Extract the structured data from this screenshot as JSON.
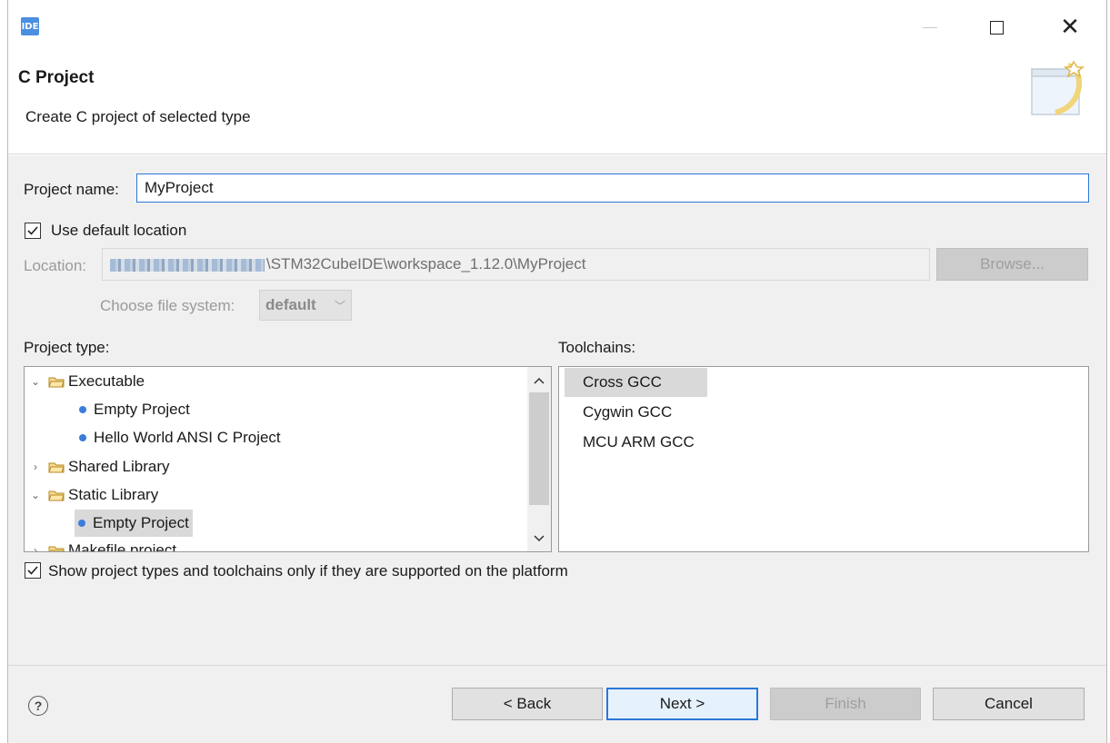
{
  "window": {
    "app_icon": "IDE",
    "min_icon": "minimize-icon",
    "max_icon": "maximize-icon",
    "close_icon": "close-icon"
  },
  "header": {
    "title": "C Project",
    "description": "Create C project of selected type"
  },
  "form": {
    "project_name_label": "Project name:",
    "project_name_value": "MyProject",
    "use_default_location_label": "Use default location",
    "use_default_location_checked": true,
    "location_label": "Location:",
    "location_value_suffix": "\\STM32CubeIDE\\workspace_1.12.0\\MyProject",
    "browse_label": "Browse...",
    "file_system_label": "Choose file system:",
    "file_system_value": "default"
  },
  "project_type": {
    "label": "Project type:",
    "items": [
      {
        "label": "Executable",
        "kind": "folder",
        "expanded": true
      },
      {
        "label": "Empty Project",
        "kind": "leaf"
      },
      {
        "label": "Hello World ANSI C Project",
        "kind": "leaf"
      },
      {
        "label": "Shared Library",
        "kind": "folder",
        "expanded": false
      },
      {
        "label": "Static Library",
        "kind": "folder",
        "expanded": true
      },
      {
        "label": "Empty Project",
        "kind": "leaf",
        "selected": true
      },
      {
        "label": "Makefile project",
        "kind": "folder",
        "expanded": false
      }
    ]
  },
  "toolchains": {
    "label": "Toolchains:",
    "items": [
      {
        "label": "Cross GCC",
        "selected": true
      },
      {
        "label": "Cygwin GCC"
      },
      {
        "label": "MCU ARM GCC"
      }
    ]
  },
  "filter": {
    "label": "Show project types and toolchains only if they are supported on the platform",
    "checked": true
  },
  "footer": {
    "help_icon": "help-icon",
    "back_label": "< Back",
    "next_label": "Next >",
    "finish_label": "Finish",
    "cancel_label": "Cancel"
  },
  "colors": {
    "focus_border": "#2a78d6",
    "selection_bg": "#d9d9d9",
    "dialog_bg": "#f0f0f0"
  }
}
